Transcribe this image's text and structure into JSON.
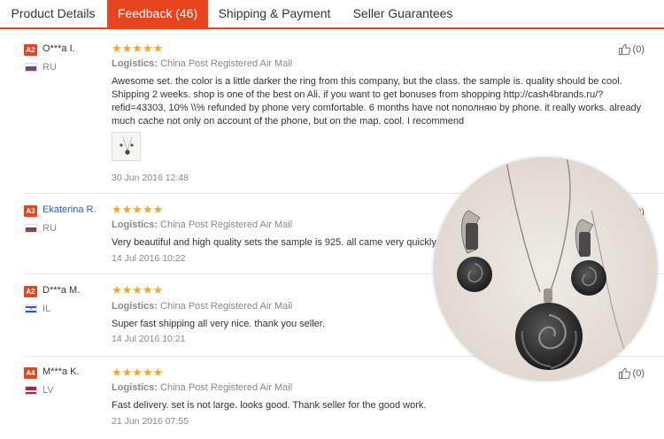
{
  "tabs": [
    {
      "label": "Product Details",
      "active": false
    },
    {
      "label": "Feedback (46)",
      "active": true
    },
    {
      "label": "Shipping & Payment",
      "active": false
    },
    {
      "label": "Seller Guarantees",
      "active": false
    }
  ],
  "logistics_label": "Logistics:",
  "reviews": [
    {
      "badge": "A2",
      "name": "O***a I.",
      "country": "RU",
      "rating": 5,
      "logistics": "China Post Registered Air Mail",
      "text": "Awesome set. the color is a little darker the ring from this company, but the class. the sample is. quality should be cool. Shipping 2 weeks. shop is one of the best on Ali. if you want to get bonuses from shopping http://cash4brands.ru/?refid=43303, 10% \\\\% refunded by phone very comfortable. 6 months have not пополняю by phone. it really works. already much cache not only on account of the phone, but on the map. cool. I recommend",
      "date": "30 Jun 2016 12:48",
      "likes": "(0)"
    },
    {
      "badge": "A3",
      "name": "Ekaterina R.",
      "country": "RU",
      "rating": 5,
      "logistics": "China Post Registered Air Mail",
      "text": "Very beautiful and high quality sets the sample is 925. all came very quickly.",
      "date": "14 Jul 2016 10:22",
      "likes": "(0)"
    },
    {
      "badge": "A2",
      "name": "D***a M.",
      "country": "IL",
      "rating": 5,
      "logistics": "China Post Registered Air Mail",
      "text": "Super fast shipping all very nice. thank you seller.",
      "date": "14 Jul 2016 10:21",
      "likes": "(0)"
    },
    {
      "badge": "A4",
      "name": "M***a K.",
      "country": "LV",
      "rating": 5,
      "logistics": "China Post Registered Air Mail",
      "text": "Fast delivery. set is not large. looks good. Thank seller for the good work.",
      "date": "21 Jun 2016 07:55",
      "likes": "(0)"
    }
  ],
  "colors": {
    "accent": "#e8451e",
    "star": "#f5a623",
    "link": "#1a64c8"
  }
}
